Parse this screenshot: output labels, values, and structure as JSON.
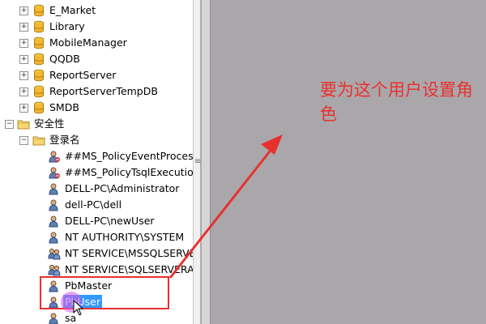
{
  "tree": {
    "databases": [
      {
        "label": "E_Market"
      },
      {
        "label": "Library"
      },
      {
        "label": "MobileManager"
      },
      {
        "label": "QQDB"
      },
      {
        "label": "ReportServer"
      },
      {
        "label": "ReportServerTempDB"
      },
      {
        "label": "SMDB"
      }
    ],
    "security_folder": {
      "label": "安全性"
    },
    "logins_folder": {
      "label": "登录名"
    },
    "logins": [
      {
        "label": "##MS_PolicyEventProcessin",
        "icon": "login-disabled-icon"
      },
      {
        "label": "##MS_PolicyTsqlExecutionL",
        "icon": "login-disabled-icon"
      },
      {
        "label": "DELL-PC\\Administrator",
        "icon": "login-user-icon"
      },
      {
        "label": "dell-PC\\dell",
        "icon": "login-user-icon"
      },
      {
        "label": "DELL-PC\\newUser",
        "icon": "login-user-icon"
      },
      {
        "label": "NT AUTHORITY\\SYSTEM",
        "icon": "login-user-icon"
      },
      {
        "label": "NT SERVICE\\MSSQLSERVE",
        "icon": "login-group-icon"
      },
      {
        "label": "NT SERVICE\\SQLSERVERAC",
        "icon": "login-group-icon"
      },
      {
        "label": "PbMaster",
        "icon": "login-user-icon"
      },
      {
        "label": "PbUser",
        "icon": "login-user-icon",
        "selected": true
      },
      {
        "label": "sa",
        "icon": "login-user-icon"
      }
    ]
  },
  "annotation": {
    "text": "要为这个用户设置角色"
  },
  "colors": {
    "annotation": "#e8312f",
    "selection": "#3399ff",
    "panel": "#aaa7ab"
  }
}
